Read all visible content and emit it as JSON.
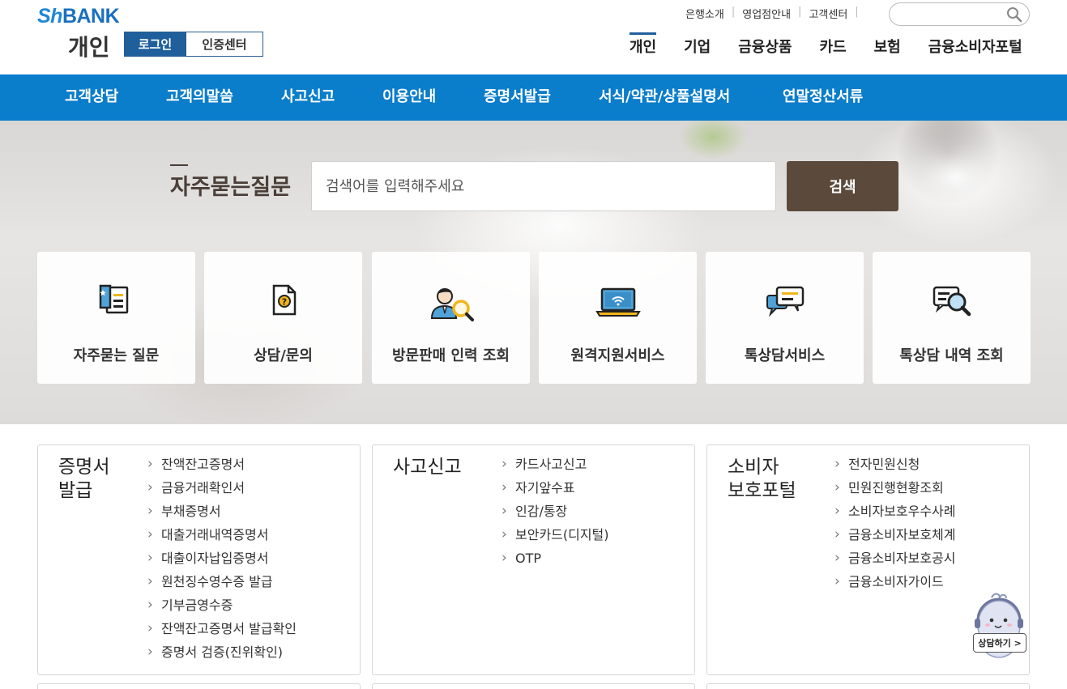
{
  "header": {
    "logo_sh": "Sh",
    "logo_bank": "BANK",
    "section": "개인",
    "login_label": "로그인",
    "cert_center_label": "인증센터",
    "util_links": [
      "은행소개",
      "영업점안내",
      "고객센터"
    ],
    "gnb": [
      "개인",
      "기업",
      "금융상품",
      "카드",
      "보험",
      "금융소비자포털"
    ],
    "gnb_active": "개인"
  },
  "subnav": [
    "고객상담",
    "고객의말씀",
    "사고신고",
    "이용안내",
    "증명서발급",
    "서식/약관/상품설명서",
    "연말정산서류"
  ],
  "hero": {
    "faq_title": "자주묻는질문",
    "search_placeholder": "검색어를 입력해주세요",
    "search_button": "검색",
    "quick_links": [
      {
        "label": "자주묻는 질문",
        "icon": "faq-book-icon"
      },
      {
        "label": "상담/문의",
        "icon": "question-document-icon"
      },
      {
        "label": "방문판매 인력 조회",
        "icon": "person-search-icon"
      },
      {
        "label": "원격지원서비스",
        "icon": "laptop-wifi-icon"
      },
      {
        "label": "톡상담서비스",
        "icon": "chat-bubble-icon"
      },
      {
        "label": "톡상담 내역 조회",
        "icon": "chat-search-icon"
      }
    ]
  },
  "panels": [
    {
      "title_line1": "증명서",
      "title_line2": "발급",
      "items": [
        "잔액잔고증명서",
        "금융거래확인서",
        "부채증명서",
        "대출거래내역증명서",
        "대출이자납입증명서",
        "원천징수영수증 발급",
        "기부금영수증",
        "잔액잔고증명서 발급확인",
        "증명서 검증(진위확인)"
      ]
    },
    {
      "title_line1": "사고신고",
      "title_line2": "",
      "items": [
        "카드사고신고",
        "자기앞수표",
        "인감/통장",
        "보안카드(디지털)",
        "OTP"
      ]
    },
    {
      "title_line1": "소비자",
      "title_line2": "보호포털",
      "items": [
        "전자민원신청",
        "민원진행현황조회",
        "소비자보호우수사례",
        "금융소비자보호체계",
        "금융소비자보호공시",
        "금융소비자가이드"
      ]
    }
  ],
  "chatbot": {
    "label": "상담하기 >"
  }
}
